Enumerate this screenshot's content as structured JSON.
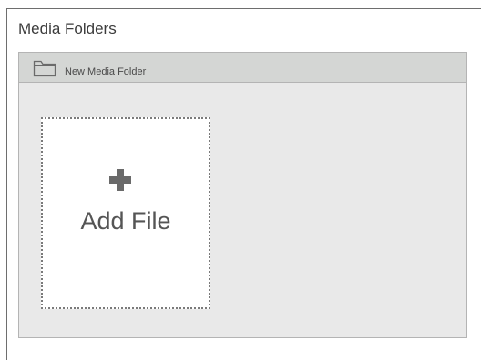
{
  "section": {
    "title": "Media Folders"
  },
  "panel": {
    "new_folder_label": "New Media Folder",
    "add_file_label": "Add File"
  },
  "icons": {
    "folder": "folder-icon",
    "add": "plus-icon"
  },
  "colors": {
    "panel_bg": "#e9e9e9",
    "header_bg": "#d4d6d4",
    "icon": "#6a6a6a"
  }
}
